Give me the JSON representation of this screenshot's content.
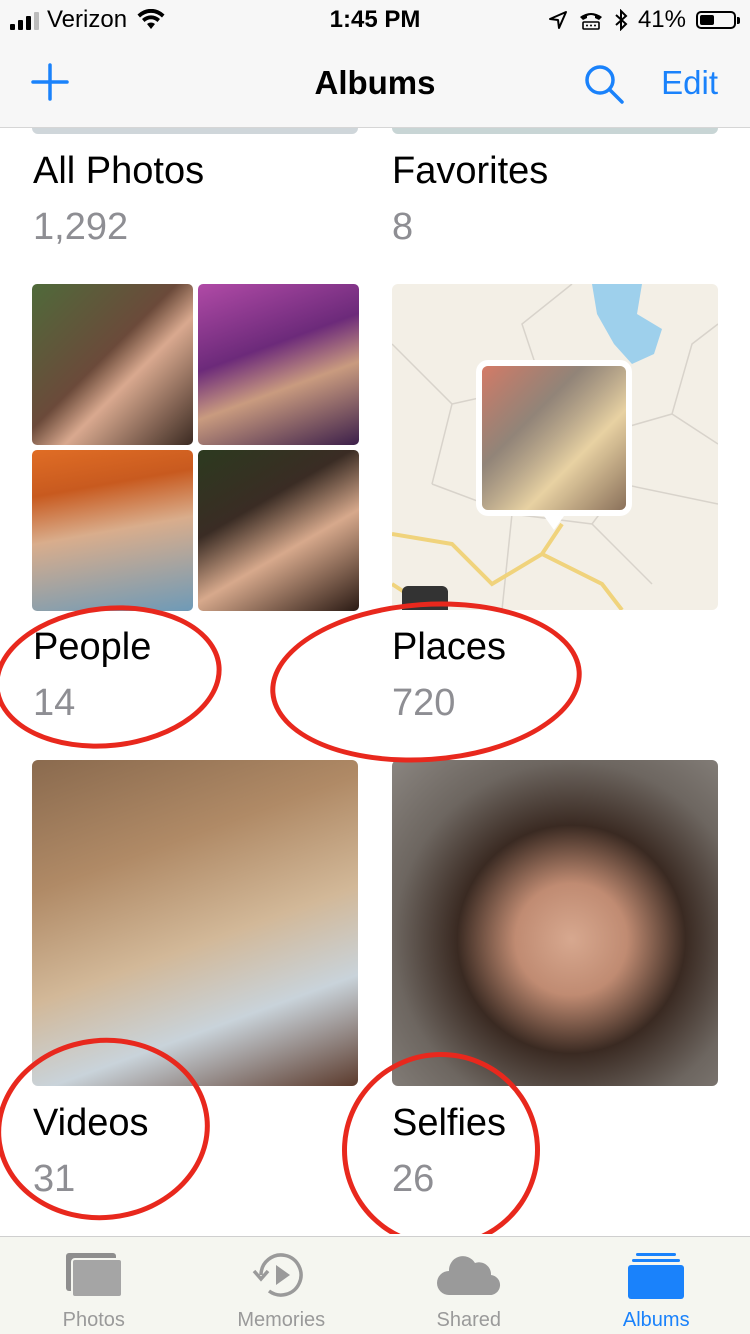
{
  "status_bar": {
    "carrier": "Verizon",
    "time": "1:45 PM",
    "battery": "41%"
  },
  "nav": {
    "title": "Albums",
    "edit_label": "Edit"
  },
  "albums": [
    {
      "name": "All Photos",
      "count": "1,292"
    },
    {
      "name": "Favorites",
      "count": "8"
    },
    {
      "name": "People",
      "count": "14"
    },
    {
      "name": "Places",
      "count": "720"
    },
    {
      "name": "Videos",
      "count": "31"
    },
    {
      "name": "Selfies",
      "count": "26"
    }
  ],
  "tabs": [
    {
      "label": "Photos",
      "icon": "photos-icon",
      "active": false
    },
    {
      "label": "Memories",
      "icon": "memories-icon",
      "active": false
    },
    {
      "label": "Shared",
      "icon": "cloud-icon",
      "active": false
    },
    {
      "label": "Albums",
      "icon": "albums-icon",
      "active": true
    }
  ],
  "colors": {
    "accent": "#1a82fb",
    "annotation": "#e8281d",
    "secondary_text": "#8e8e93"
  }
}
